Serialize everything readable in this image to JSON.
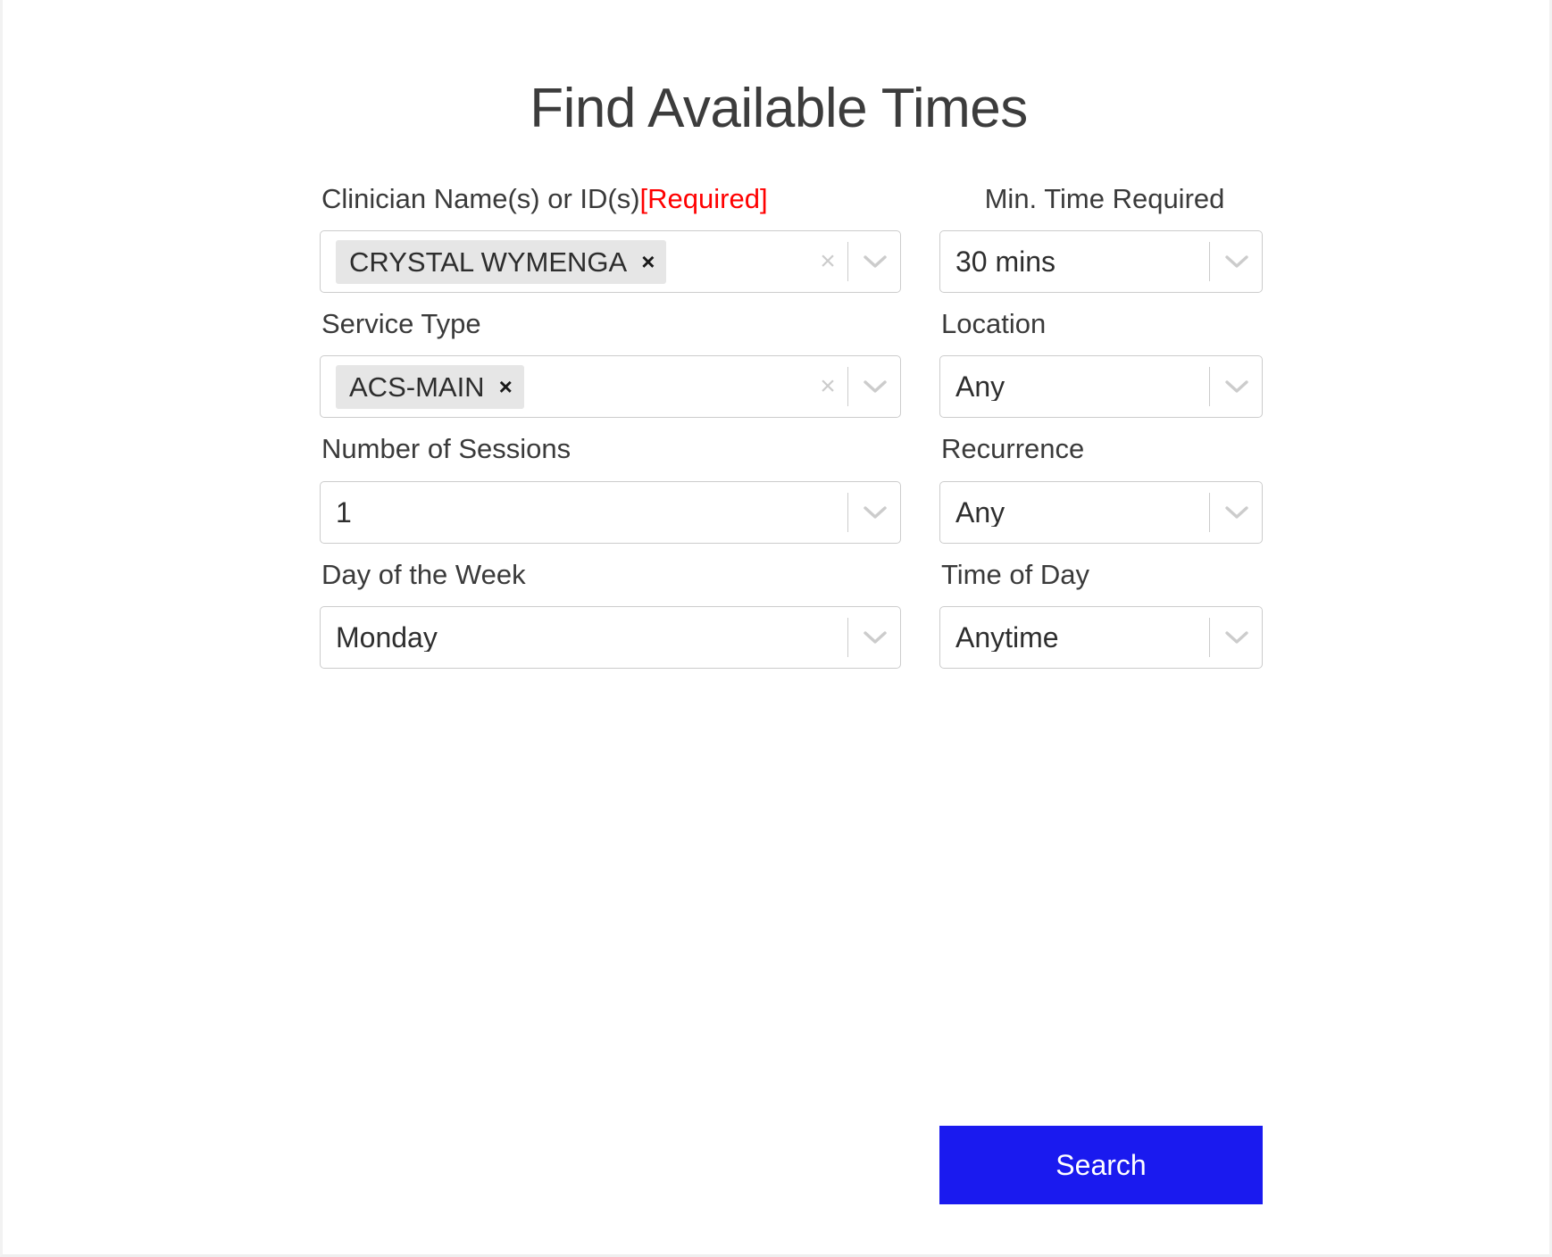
{
  "page": {
    "title": "Find Available Times"
  },
  "colors": {
    "accent": "#1a1aef",
    "required": "#ff0000",
    "chip_bg": "#e6e6e6",
    "border": "#cccccc",
    "text": "#333333"
  },
  "icons": {
    "clear": "×",
    "chip_remove": "×",
    "chevron_down": "chevron-down-icon"
  },
  "left_column": {
    "clinician": {
      "label": "Clinician Name(s) or ID(s)",
      "required_text": "[Required]",
      "type": "multiselect",
      "selected": [
        {
          "value": "CRYSTAL WYMENGA"
        }
      ]
    },
    "service_type": {
      "label": "Service Type",
      "type": "multiselect",
      "selected": [
        {
          "value": "ACS-MAIN"
        }
      ]
    },
    "number_of_sessions": {
      "label": "Number of Sessions",
      "type": "select",
      "value": "1"
    },
    "day_of_week": {
      "label": "Day of the Week",
      "type": "select",
      "value": "Monday"
    }
  },
  "right_column": {
    "min_time_required": {
      "label": "Min. Time Required",
      "type": "select",
      "value": "30 mins"
    },
    "location": {
      "label": "Location",
      "type": "select",
      "value": "Any"
    },
    "recurrence": {
      "label": "Recurrence",
      "type": "select",
      "value": "Any"
    },
    "time_of_day": {
      "label": "Time of Day",
      "type": "select",
      "value": "Anytime"
    }
  },
  "actions": {
    "search_label": "Search"
  }
}
